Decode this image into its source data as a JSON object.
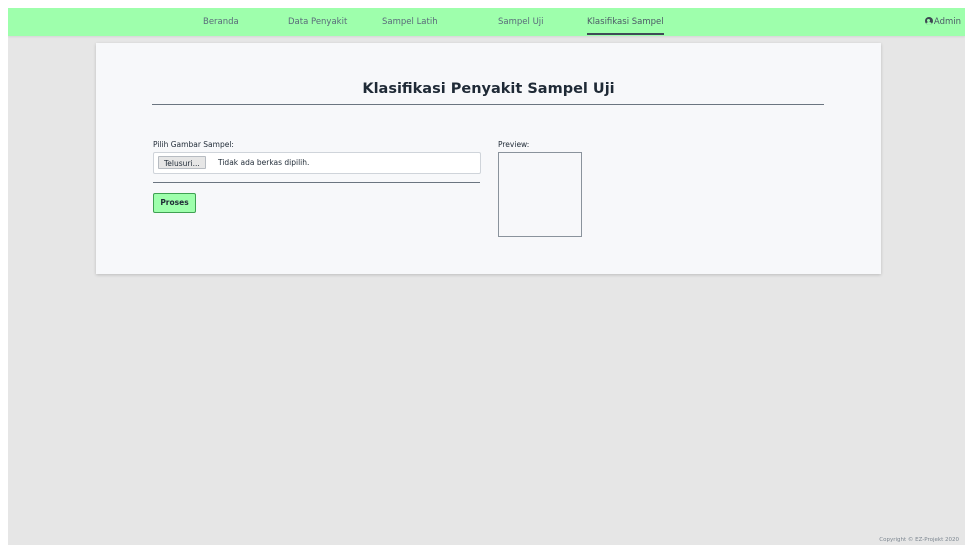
{
  "nav": {
    "items": [
      {
        "label": "Beranda",
        "active": false
      },
      {
        "label": "Data Penyakit",
        "active": false
      },
      {
        "label": "Sampel Latih",
        "active": false
      },
      {
        "label": "Sampel Uji",
        "active": false
      },
      {
        "label": "Klasifikasi Sampel",
        "active": true
      }
    ],
    "user_label": "Admin",
    "user_icon": "user-circle-icon",
    "background_color": "#9effac"
  },
  "main": {
    "title": "Klasifikasi Penyakit Sampel Uji",
    "file_field": {
      "label": "Pilih Gambar Sampel:",
      "browse_button": "Telusuri...",
      "status": "Tidak ada berkas dipilih."
    },
    "process_button": "Proses",
    "preview_label": "Preview:"
  },
  "footer": {
    "copyright": "Copyright © EZ-Projekt 2020"
  }
}
